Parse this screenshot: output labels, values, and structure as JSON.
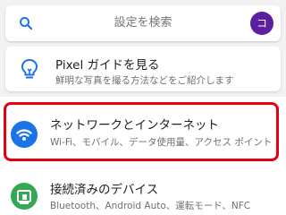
{
  "search": {
    "placeholder": "設定を検索",
    "avatar_letter": "コ",
    "avatar_color": "#5b1fa0"
  },
  "suggestion": {
    "icon": "lightbulb-icon",
    "title": "Pixel ガイドを見る",
    "subtitle": "鮮明な写真を撮る方法などをご紹介します"
  },
  "settings": [
    {
      "icon": "wifi-icon",
      "icon_color": "#1a73e8",
      "title": "ネットワークとインターネット",
      "subtitle": "Wi-Fi、モバイル、データ使用量、アクセス ポイント"
    },
    {
      "icon": "connected-devices-icon",
      "icon_color": "#34a853",
      "title": "接続済みのデバイス",
      "subtitle": "Bluetooth、Android Auto、運転モード、NFC"
    }
  ]
}
